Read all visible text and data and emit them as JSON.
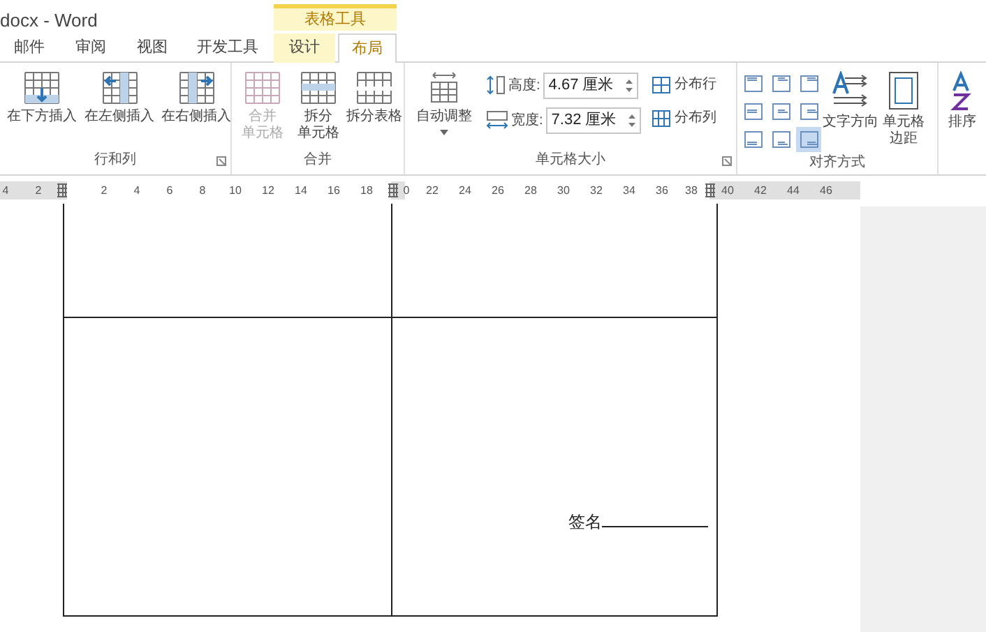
{
  "window": {
    "title": "docx - Word"
  },
  "context_tab_group": "表格工具",
  "tabs": [
    {
      "label": "邮件",
      "selected": false
    },
    {
      "label": "审阅",
      "selected": false
    },
    {
      "label": "视图",
      "selected": false
    },
    {
      "label": "开发工具",
      "selected": false
    },
    {
      "label": "设计",
      "selected": false,
      "contextual": true
    },
    {
      "label": "布局",
      "selected": true,
      "contextual": true
    }
  ],
  "ribbon": {
    "rows_and_columns": {
      "label": "行和列",
      "buttons": [
        {
          "label": "在下方插入",
          "kind": "below"
        },
        {
          "label": "在左侧插入",
          "kind": "left"
        },
        {
          "label": "在右侧插入",
          "kind": "right"
        }
      ]
    },
    "merge": {
      "label": "合并",
      "buttons": [
        {
          "label": [
            "合并",
            "单元格"
          ],
          "kind": "merge",
          "disabled": true
        },
        {
          "label": [
            "拆分",
            "单元格"
          ],
          "kind": "split-cells",
          "disabled": false
        },
        {
          "label": "拆分表格",
          "kind": "split-table",
          "disabled": false
        }
      ]
    },
    "cell_size": {
      "label": "单元格大小",
      "autofit": "自动调整",
      "height": {
        "label": "高度:",
        "value": "4.67 厘米"
      },
      "width": {
        "label": "宽度:",
        "value": "7.32 厘米"
      },
      "distribute_rows": "分布行",
      "distribute_columns": "分布列"
    },
    "alignment": {
      "label": "对齐方式",
      "cells": [
        {
          "selected": false
        },
        {
          "selected": false
        },
        {
          "selected": false
        },
        {
          "selected": false
        },
        {
          "selected": false
        },
        {
          "selected": false
        },
        {
          "selected": false
        },
        {
          "selected": false
        },
        {
          "selected": true
        }
      ],
      "text_direction": "文字方向",
      "cell_margins": [
        "单元格",
        "边距"
      ]
    },
    "sort": {
      "label": "排序"
    }
  },
  "ruler": [
    "4",
    "2",
    "2",
    "4",
    "6",
    "8",
    "10",
    "12",
    "14",
    "16",
    "18",
    "0",
    "22",
    "24",
    "26",
    "28",
    "30",
    "32",
    "34",
    "36",
    "38",
    "40",
    "42",
    "44",
    "46"
  ],
  "document": {
    "signature_label": "签名"
  }
}
